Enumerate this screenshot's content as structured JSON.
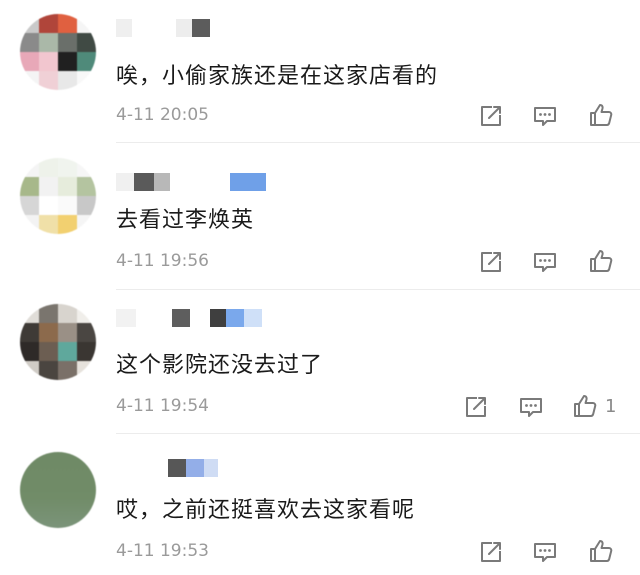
{
  "comments": [
    {
      "text": "唉，小偷家族还是在这家店看的",
      "timestamp": "4-11 20:05",
      "likes": ""
    },
    {
      "text": "去看过李焕英",
      "timestamp": "4-11 19:56",
      "likes": ""
    },
    {
      "text": "这个影院还没去过了",
      "timestamp": "4-11 19:54",
      "likes": "1"
    },
    {
      "text": "哎，之前还挺喜欢去这家看呢",
      "timestamp": "4-11 19:53",
      "likes": ""
    }
  ],
  "icons": {
    "share": "share-icon",
    "reply": "comment-icon",
    "like": "thumbs-up-icon"
  },
  "colors": {
    "text": "#1a1a1a",
    "meta": "#9a9a9a",
    "icon": "#7a7a7a"
  }
}
